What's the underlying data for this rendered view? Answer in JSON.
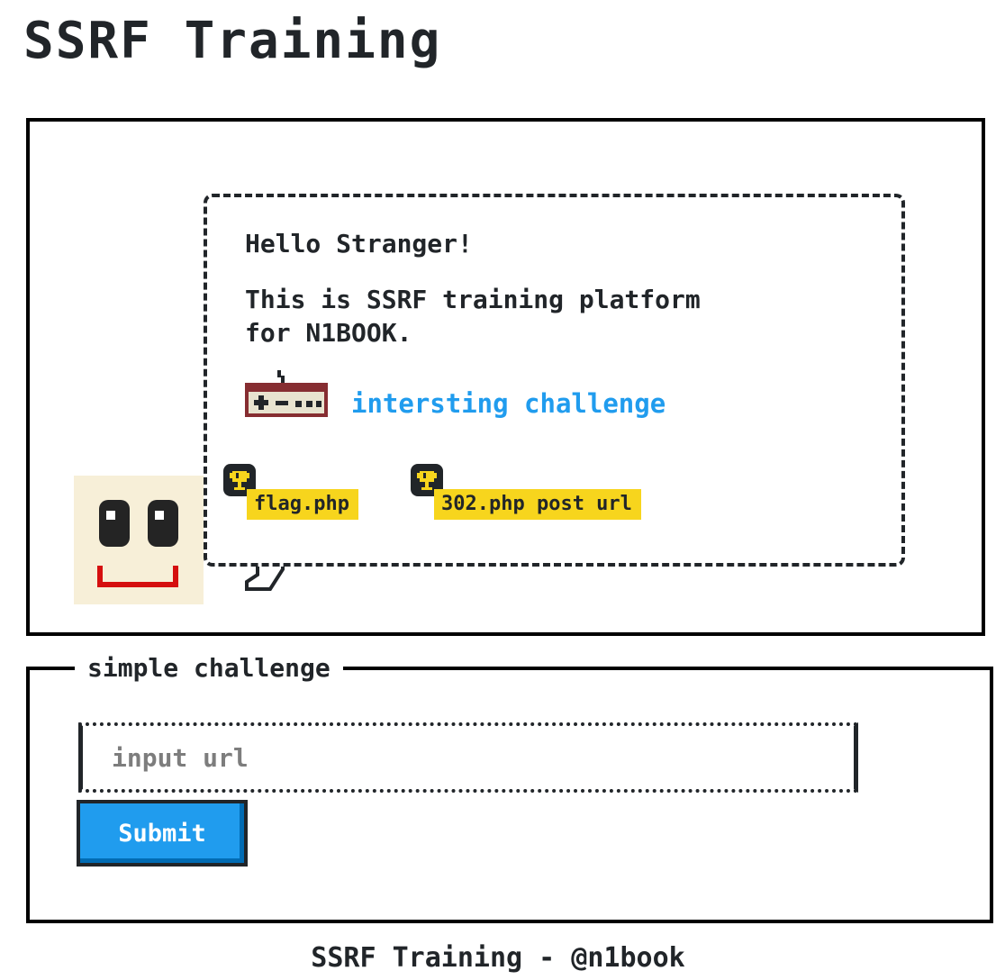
{
  "header": {
    "title": "SSRF Training"
  },
  "intro": {
    "greeting": "Hello Stranger!",
    "description": "This is SSRF training platform for N1BOOK.",
    "challenge_link": "intersting challenge",
    "controller_icon": "game-controller-icon",
    "avatar_icon": "smiley-face-icon",
    "badges": [
      {
        "icon": "trophy-icon",
        "label": "flag.php"
      },
      {
        "icon": "trophy-icon",
        "label": "302.php post url"
      }
    ]
  },
  "form": {
    "title": "simple challenge",
    "url_input": {
      "placeholder": "input url",
      "value": ""
    },
    "submit_label": "Submit"
  },
  "footer": {
    "text": "SSRF Training - @n1book"
  },
  "colors": {
    "text": "#212529",
    "link": "#209cee",
    "badge": "#f7d51d",
    "button": "#209cee",
    "avatar_skin": "#f7efd8",
    "avatar_mouth": "#d50f0f",
    "controller": "#862d31"
  }
}
